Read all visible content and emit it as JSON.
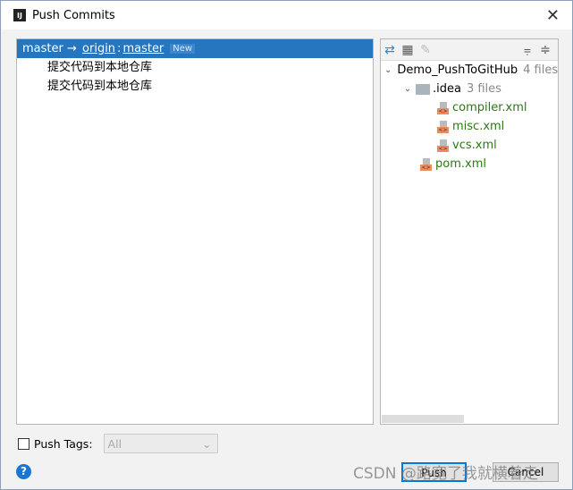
{
  "window": {
    "title": "Push Commits",
    "logo": "IJ"
  },
  "branch": {
    "local": "master",
    "arrow": "→",
    "remote": "origin",
    "sep": ":",
    "remote_branch": "master",
    "badge": "New"
  },
  "commits": [
    "提交代码到本地仓库",
    "提交代码到本地仓库"
  ],
  "tree": {
    "root": {
      "name": "Demo_PushToGitHub",
      "count": "4 files"
    },
    "folder": {
      "name": ".idea",
      "count": "3 files"
    },
    "files": [
      "compiler.xml",
      "misc.xml",
      "vcs.xml"
    ],
    "root_file": "pom.xml"
  },
  "bottom": {
    "push_tags_label": "Push Tags:",
    "tags_value": "All",
    "push": "Push",
    "cancel": "Cancel",
    "help": "?"
  },
  "watermark": "CSDN @路宽了我就横着走",
  "colors": {
    "selection": "#2675bf",
    "file_added": "#2a7a12",
    "default_button_border": "#0078d7"
  }
}
